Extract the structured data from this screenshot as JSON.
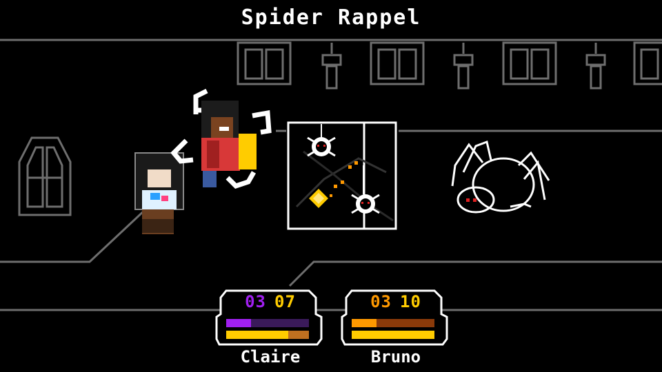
{
  "battle": {
    "title": "Spider Rappel"
  },
  "party": [
    {
      "name": "Claire",
      "stat_a": "03",
      "stat_b": "07",
      "color_a": "#a020f0",
      "color_b": "#ffcc00",
      "top_bar_fraction": 0.3,
      "bottom_bar_fraction": 0.75
    },
    {
      "name": "Bruno",
      "stat_a": "03",
      "stat_b": "10",
      "color_a": "#ff9900",
      "color_b": "#ffcc00",
      "top_bar_fraction": 0.3,
      "bottom_bar_fraction": 1.0
    }
  ],
  "colors": {
    "background": "#000000",
    "line": "#6e6e6e",
    "white": "#ffffff",
    "yellow": "#ffcc00",
    "purple": "#a020f0",
    "orange": "#ff9900",
    "red": "#e02020"
  }
}
